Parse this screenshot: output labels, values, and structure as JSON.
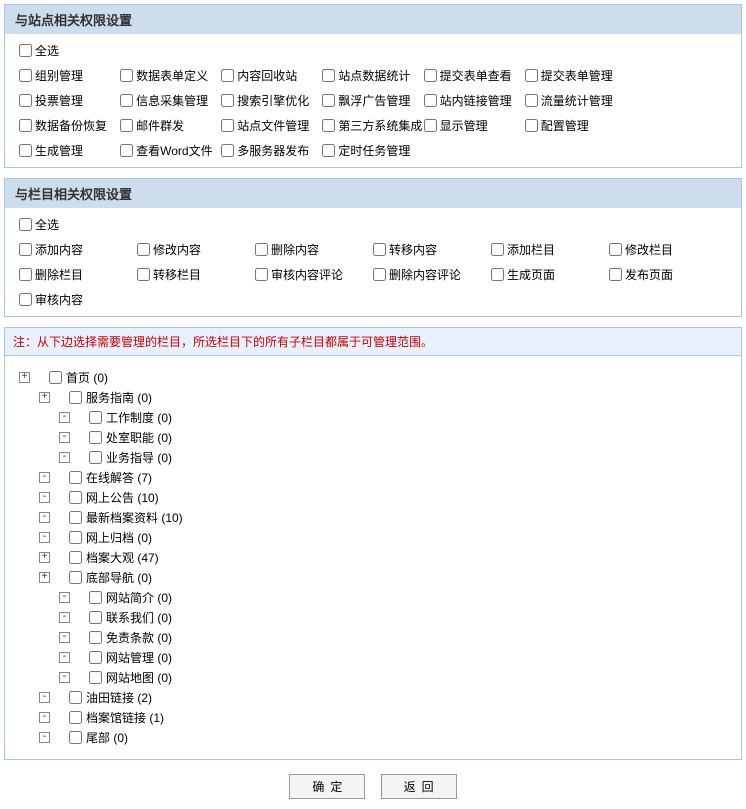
{
  "sitePanel": {
    "title": "与站点相关权限设置",
    "selectAll": "全选",
    "items": [
      "组别管理",
      "数据表单定义",
      "内容回收站",
      "站点数据统计",
      "提交表单查看",
      "提交表单管理",
      "",
      "投票管理",
      "信息采集管理",
      "搜索引擎优化",
      "飘浮广告管理",
      "站内链接管理",
      "流量统计管理",
      "",
      "数据备份恢复",
      "邮件群发",
      "站点文件管理",
      "第三方系统集成",
      "显示管理",
      "配置管理",
      "",
      "生成管理",
      "查看Word文件",
      "多服务器发布",
      "定时任务管理",
      "",
      "",
      ""
    ]
  },
  "columnPanel": {
    "title": "与栏目相关权限设置",
    "selectAll": "全选",
    "items": [
      "添加内容",
      "修改内容",
      "删除内容",
      "转移内容",
      "添加栏目",
      "修改栏目",
      "删除栏目",
      "转移栏目",
      "审核内容评论",
      "删除内容评论",
      "生成页面",
      "发布页面",
      "审核内容",
      "",
      "",
      "",
      "",
      ""
    ]
  },
  "note": "注：从下边选择需要管理的栏目，所选栏目下的所有子栏目都属于可管理范围。",
  "tree": [
    {
      "tg": "+",
      "label": "首页",
      "count": 0,
      "children": [
        {
          "tg": "+",
          "label": "服务指南",
          "count": 0,
          "children": [
            {
              "tg": "-",
              "label": "工作制度",
              "count": 0
            },
            {
              "tg": "-",
              "label": "处室职能",
              "count": 0
            },
            {
              "tg": "-",
              "label": "业务指导",
              "count": 0
            }
          ]
        },
        {
          "tg": "-",
          "label": "在线解答",
          "count": 7
        },
        {
          "tg": "-",
          "label": "网上公告",
          "count": 10
        },
        {
          "tg": "-",
          "label": "最新档案资料",
          "count": 10
        },
        {
          "tg": "-",
          "label": "网上归档",
          "count": 0
        },
        {
          "tg": "+",
          "label": "档案大观",
          "count": 47
        },
        {
          "tg": "+",
          "label": "底部导航",
          "count": 0,
          "children": [
            {
              "tg": "-",
              "label": "网站简介",
              "count": 0
            },
            {
              "tg": "-",
              "label": "联系我们",
              "count": 0
            },
            {
              "tg": "-",
              "label": "免责条款",
              "count": 0
            },
            {
              "tg": "-",
              "label": "网站管理",
              "count": 0
            },
            {
              "tg": "-",
              "label": "网站地图",
              "count": 0
            }
          ]
        },
        {
          "tg": "-",
          "label": "油田链接",
          "count": 2
        },
        {
          "tg": "-",
          "label": "档案馆链接",
          "count": 1
        },
        {
          "tg": "-",
          "label": "尾部",
          "count": 0
        }
      ]
    }
  ],
  "buttons": {
    "ok": "确定",
    "back": "返回"
  }
}
